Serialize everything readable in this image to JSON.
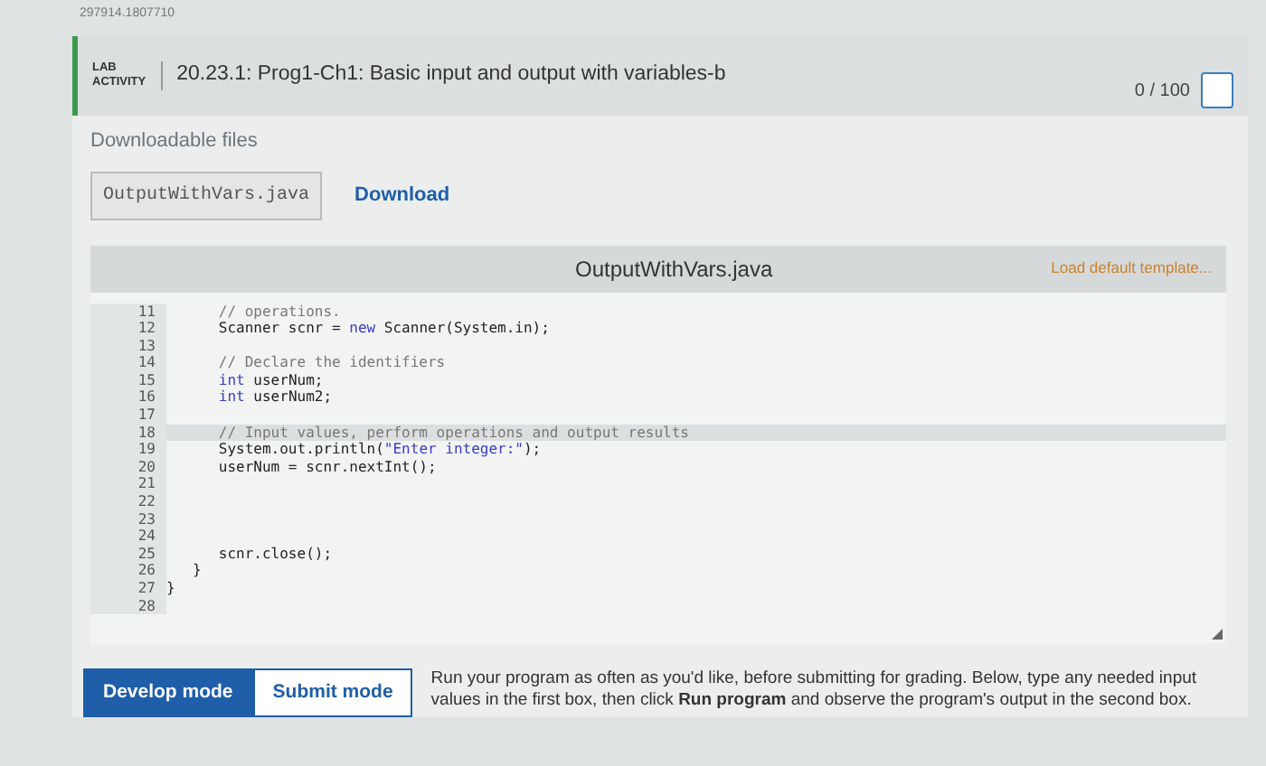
{
  "top_id": "297914.1807710",
  "header": {
    "badge_line1": "LAB",
    "badge_line2": "ACTIVITY",
    "title": "20.23.1: Prog1-Ch1: Basic input and output with variables-b",
    "score": "0 / 100",
    "complete": false
  },
  "downloads": {
    "label": "Downloadable files",
    "file": "OutputWithVars.java",
    "link": "Download"
  },
  "editor": {
    "filename": "OutputWithVars.java",
    "template_link": "Load default template...",
    "lines": [
      {
        "number": "11",
        "selected": false,
        "segments": [
          {
            "kind": "comment",
            "text": "      // operations."
          }
        ]
      },
      {
        "number": "12",
        "selected": false,
        "segments": [
          {
            "kind": "plain",
            "text": "      Scanner scnr = "
          },
          {
            "kind": "keyword",
            "text": "new"
          },
          {
            "kind": "plain",
            "text": " Scanner(System.in);"
          }
        ]
      },
      {
        "number": "13",
        "selected": false
      },
      {
        "number": "14",
        "selected": false,
        "segments": [
          {
            "kind": "comment",
            "text": "      // Declare the identifiers"
          }
        ]
      },
      {
        "number": "15",
        "selected": false,
        "segments": [
          {
            "kind": "keyword",
            "text": "      int"
          },
          {
            "kind": "plain",
            "text": " userNum;"
          }
        ]
      },
      {
        "number": "16",
        "selected": false,
        "segments": [
          {
            "kind": "keyword",
            "text": "      int"
          },
          {
            "kind": "plain",
            "text": " userNum2;"
          }
        ]
      },
      {
        "number": "17",
        "selected": false
      },
      {
        "number": "18",
        "selected": true,
        "segments": [
          {
            "kind": "comment",
            "text": "      // Input values, perform operations and output results"
          }
        ]
      },
      {
        "number": "19",
        "selected": false,
        "segments": [
          {
            "kind": "plain",
            "text": "      System.out.println("
          },
          {
            "kind": "string",
            "text": "\"Enter integer:\""
          },
          {
            "kind": "plain",
            "text": ");"
          }
        ]
      },
      {
        "number": "20",
        "selected": false,
        "segments": [
          {
            "kind": "plain",
            "text": "      userNum = scnr.nextInt();"
          }
        ]
      },
      {
        "number": "21",
        "selected": false
      },
      {
        "number": "22",
        "selected": false
      },
      {
        "number": "23",
        "selected": false
      },
      {
        "number": "24",
        "selected": false
      },
      {
        "number": "25",
        "selected": false,
        "segments": [
          {
            "kind": "plain",
            "text": "      scnr.close();"
          }
        ]
      },
      {
        "number": "26",
        "selected": false,
        "segments": [
          {
            "kind": "plain",
            "text": "   }"
          }
        ]
      },
      {
        "number": "27",
        "selected": false,
        "segments": [
          {
            "kind": "plain",
            "text": "}"
          }
        ]
      },
      {
        "number": "28",
        "selected": false
      }
    ]
  },
  "modes": [
    {
      "label": "Develop mode",
      "selected": true
    },
    {
      "label": "Submit mode",
      "selected": false
    }
  ],
  "instructions": "Run your program as often as you'd like, before submitting for grading. Below, type any needed input values in the first box, then click **Run program** and observe the program's output in the second box."
}
